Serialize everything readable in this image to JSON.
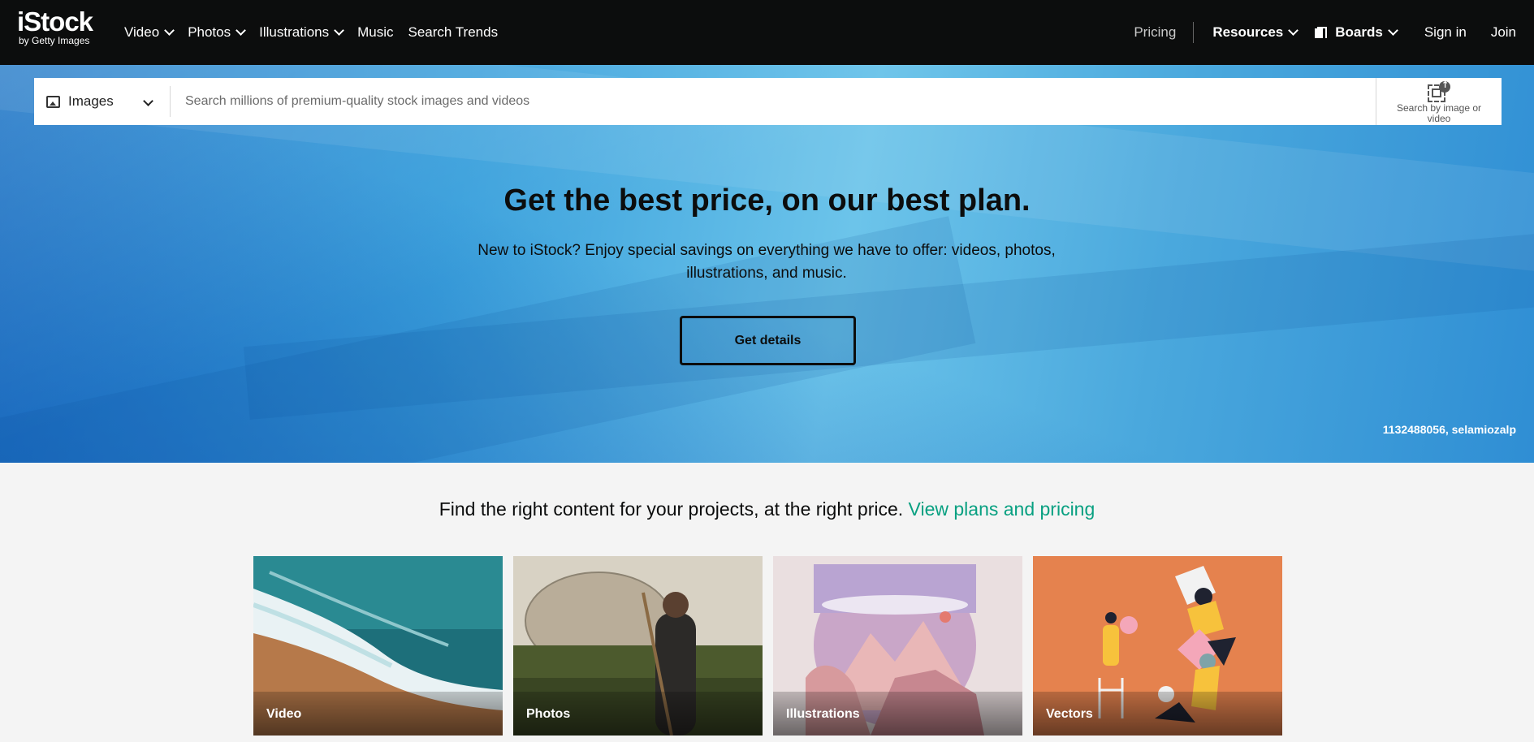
{
  "header": {
    "logo_brand": "iStock",
    "logo_sub": "by Getty Images",
    "nav_left": [
      {
        "label": "Video",
        "dropdown": true
      },
      {
        "label": "Photos",
        "dropdown": true
      },
      {
        "label": "Illustrations",
        "dropdown": true
      },
      {
        "label": "Music",
        "dropdown": false
      },
      {
        "label": "Search Trends",
        "dropdown": false
      }
    ],
    "pricing": "Pricing",
    "resources": "Resources",
    "boards": "Boards",
    "sign_in": "Sign in",
    "join": "Join"
  },
  "search": {
    "type_label": "Images",
    "placeholder": "Search millions of premium-quality stock images and videos",
    "by_image_label": "Search by image or video"
  },
  "hero": {
    "title": "Get the best price, on our best plan.",
    "subtitle": "New to iStock? Enjoy special savings on everything we have to offer: videos, photos, illustrations, and music.",
    "button": "Get details",
    "credit": "1132488056, selamiozalp"
  },
  "promo": {
    "text": "Find the right content for your projects, at the right price.",
    "link": "View plans and pricing"
  },
  "tiles": [
    {
      "label": "Video"
    },
    {
      "label": "Photos"
    },
    {
      "label": "Illustrations"
    },
    {
      "label": "Vectors"
    }
  ],
  "colors": {
    "nav_bg": "#0c0d0d",
    "accent_link": "#08a081",
    "page_bg": "#f4f4f4"
  }
}
